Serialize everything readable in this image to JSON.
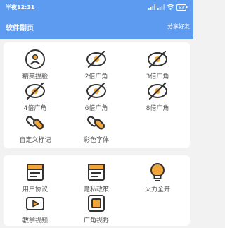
{
  "status_bar": {
    "time": "半夜12:31",
    "battery": "53"
  },
  "header": {
    "title": "软件副页",
    "share": "分享好友"
  },
  "features": [
    {
      "label": "精英捏脸",
      "icon": "face-icon"
    },
    {
      "label": "2倍广角",
      "icon": "eye-slash-icon"
    },
    {
      "label": "3倍广角",
      "icon": "eye-slash-icon"
    },
    {
      "label": "4倍广角",
      "icon": "eye-slash-icon"
    },
    {
      "label": "6倍广角",
      "icon": "eye-slash-icon"
    },
    {
      "label": "8倍广角",
      "icon": "eye-slash-icon"
    },
    {
      "label": "自定义标记",
      "icon": "link-icon"
    },
    {
      "label": "彩色字体",
      "icon": "link-icon"
    }
  ],
  "tools": [
    {
      "label": "用户协议",
      "icon": "document-icon"
    },
    {
      "label": "隐私政策",
      "icon": "document-icon"
    },
    {
      "label": "火力全开",
      "icon": "lightbulb-icon"
    },
    {
      "label": "教学视频",
      "icon": "video-icon"
    },
    {
      "label": "广角视野",
      "icon": "crop-icon"
    }
  ]
}
